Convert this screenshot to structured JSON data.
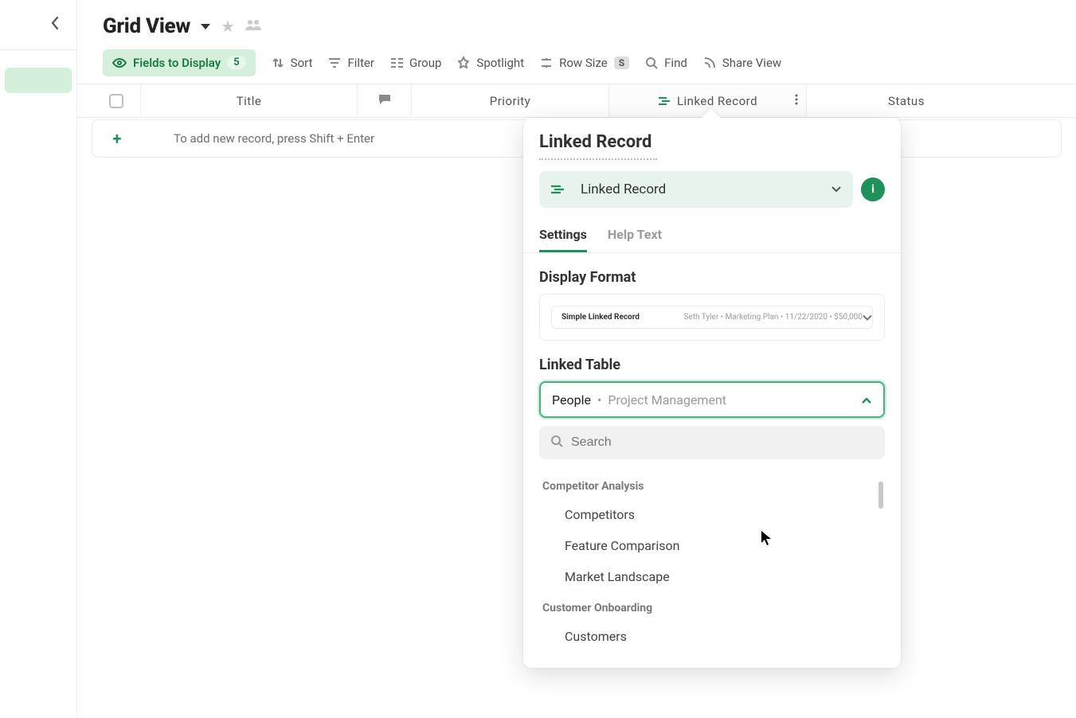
{
  "header": {
    "title": "Grid View"
  },
  "toolbar": {
    "fields_label": "Fields to Display",
    "fields_count": "5",
    "sort": "Sort",
    "filter": "Filter",
    "group": "Group",
    "spotlight": "Spotlight",
    "rowsize": "Row Size",
    "rowsize_badge": "S",
    "find": "Find",
    "share": "Share View"
  },
  "columns": {
    "title": "Title",
    "priority": "Priority",
    "linked": "Linked Record",
    "status": "Status"
  },
  "row": {
    "empty_hint": "To add new record, press Shift + Enter"
  },
  "popover": {
    "title": "Linked Record",
    "type_label": "Linked Record",
    "tabs": {
      "settings": "Settings",
      "help": "Help Text"
    },
    "display_format_label": "Display Format",
    "display_format_card": {
      "title": "Simple Linked Record",
      "meta": "Seth Tyler • Marketing Plan • 11/22/2020 • $50,000"
    },
    "linked_table_label": "Linked Table",
    "linked_table_value_primary": "People",
    "linked_table_value_secondary": "Project Management",
    "search_placeholder": "Search",
    "groups": [
      {
        "name": "Competitor Analysis",
        "items": [
          "Competitors",
          "Feature Comparison",
          "Market Landscape"
        ]
      },
      {
        "name": "Customer Onboarding",
        "items": [
          "Customers"
        ]
      }
    ]
  },
  "colors": {
    "accent": "#1e925a",
    "accent_bg": "#d4f0dd"
  }
}
